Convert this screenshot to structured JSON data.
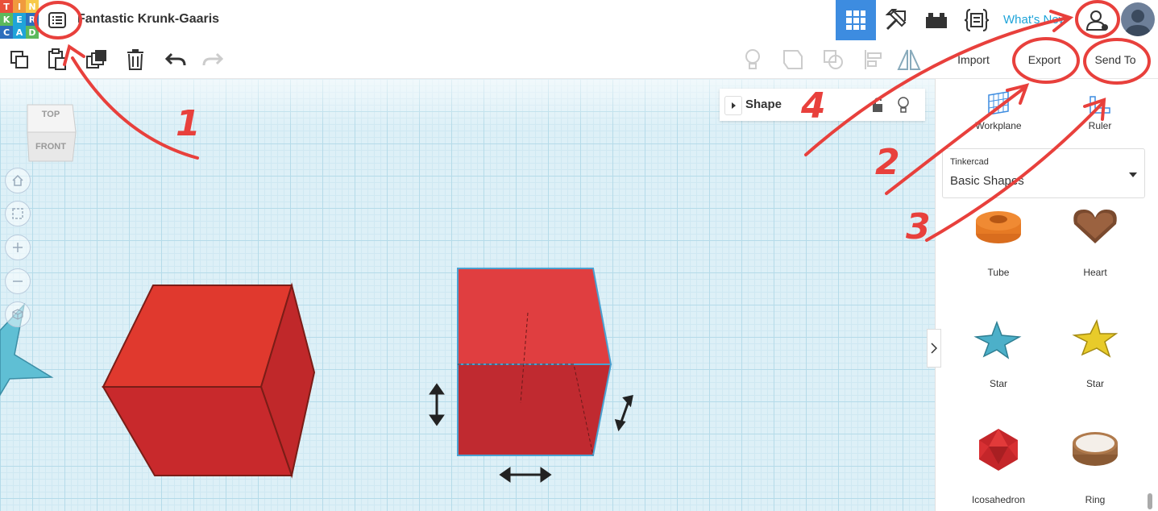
{
  "header": {
    "logo_letters": [
      "T",
      "I",
      "N",
      "K",
      "E",
      "R",
      "C",
      "A",
      "D"
    ],
    "logo_colors": [
      "#e8503a",
      "#f09a3e",
      "#f7c94a",
      "#5cb85c",
      "#1fa4d9",
      "#2c6ebd",
      "#2c6ebd",
      "#1fa4d9",
      "#5cb85c"
    ],
    "design_title": "Fantastic Krunk-Gaaris",
    "whats_new": "What's New",
    "icons": [
      "grid-view-icon",
      "pickaxe-icon",
      "bricks-icon",
      "codeblocks-icon",
      "user-icon",
      "avatar"
    ]
  },
  "toolbar": {
    "import_label": "Import",
    "export_label": "Export",
    "send_to_label": "Send To"
  },
  "viewcube": {
    "top": "TOP",
    "front": "FRONT"
  },
  "shape_panel": {
    "title": "Shape"
  },
  "sidebar": {
    "workplane_label": "Workplane",
    "ruler_label": "Ruler",
    "library_group": "Tinkercad",
    "library_value": "Basic Shapes",
    "shapes": [
      "Tube",
      "Heart",
      "Star",
      "Star",
      "Icosahedron",
      "Ring"
    ]
  },
  "annotations": {
    "n1": "1",
    "n2": "2",
    "n3": "3",
    "n4": "4"
  },
  "colors": {
    "accent": "#1fa4d9",
    "active_tab": "#3d8ce0",
    "box_red": "#d8332c",
    "annotation": "#e8403c"
  }
}
